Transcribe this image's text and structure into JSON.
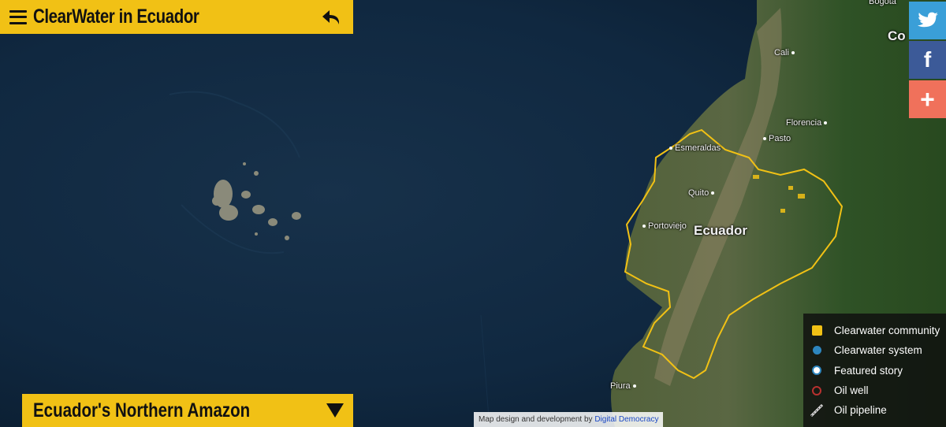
{
  "app": {
    "title": "ClearWater in Ecuador",
    "section": "Ecuador's Northern Amazon"
  },
  "share": {
    "twitter_icon": "twitter-bird-icon",
    "facebook_icon": "facebook-f-icon",
    "more_icon": "plus-icon",
    "facebook_glyph": "f",
    "more_glyph": "+"
  },
  "map": {
    "country_label": "Ecuador",
    "places": [
      "Bogotá",
      "Co",
      "Cali",
      "Florencia",
      "Pasto",
      "Esmeraldas",
      "Quito",
      "Portoviejo",
      "Piura"
    ],
    "colors": {
      "ocean": "#0f2336",
      "land": "#3e5a2e",
      "border": "#f1c115",
      "accent": "#f1c115"
    }
  },
  "legend": {
    "items": [
      {
        "label": "Clearwater community",
        "symbol": "yellow-square"
      },
      {
        "label": "Clearwater system",
        "symbol": "blue-dot"
      },
      {
        "label": "Featured story",
        "symbol": "white-dot"
      },
      {
        "label": "Oil well",
        "symbol": "red-ring"
      },
      {
        "label": "Oil pipeline",
        "symbol": "pipeline-line"
      }
    ]
  },
  "attribution": {
    "prefix": "Map design and development by ",
    "link": "Digital Democracy"
  }
}
